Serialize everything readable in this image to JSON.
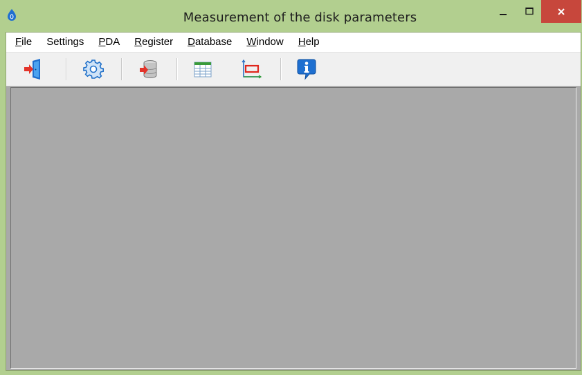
{
  "window": {
    "title": "Measurement of the disk parameters",
    "icon": "drop-icon",
    "controls": [
      "minimize-icon",
      "maximize-icon",
      "close-icon"
    ],
    "frame_color": "#b2cf8f",
    "close_color": "#c7473c"
  },
  "menu": {
    "items": [
      {
        "label_underlined": "F",
        "label_rest": "ile"
      },
      {
        "label_underlined": "",
        "label_rest": "Settings"
      },
      {
        "label_underlined": "P",
        "label_rest": "DA"
      },
      {
        "label_underlined": "R",
        "label_rest": "egister"
      },
      {
        "label_underlined": "D",
        "label_rest": "atabase"
      },
      {
        "label_underlined": "W",
        "label_rest": "indow"
      },
      {
        "label_underlined": "H",
        "label_rest": "elp"
      }
    ]
  },
  "toolbar": {
    "buttons": [
      "exit-door-icon",
      "settings-gear-icon",
      "database-import-icon",
      "table-grid-icon",
      "chart-axes-icon",
      "info-icon"
    ]
  },
  "workspace": {
    "background": "#a9a9a9"
  }
}
